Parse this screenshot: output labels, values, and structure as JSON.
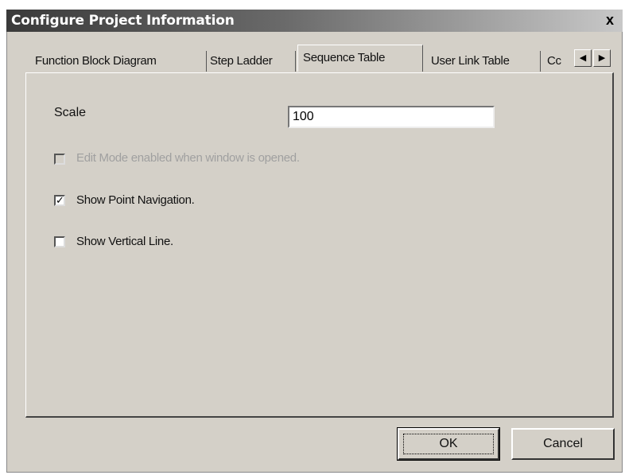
{
  "window": {
    "title": "Configure Project Information",
    "close_symbol": "x"
  },
  "tabs": [
    {
      "label": "Function Block Diagram",
      "active": false
    },
    {
      "label": "Step Ladder",
      "active": false
    },
    {
      "label": "Sequence Table",
      "active": true
    },
    {
      "label": "User Link Table",
      "active": false
    },
    {
      "label": "Cc",
      "active": false
    }
  ],
  "tab_scroll": {
    "left_icon": "◀",
    "right_icon": "▶"
  },
  "form": {
    "scale_label": "Scale",
    "scale_value": "100",
    "checkboxes": [
      {
        "label": "Edit Mode enabled when window is opened.",
        "checked": false,
        "disabled": true
      },
      {
        "label": "Show Point Navigation.",
        "checked": true,
        "disabled": false
      },
      {
        "label": "Show Vertical Line.",
        "checked": false,
        "disabled": false
      }
    ],
    "check_glyph": "✓"
  },
  "buttons": {
    "ok": "OK",
    "cancel": "Cancel"
  }
}
